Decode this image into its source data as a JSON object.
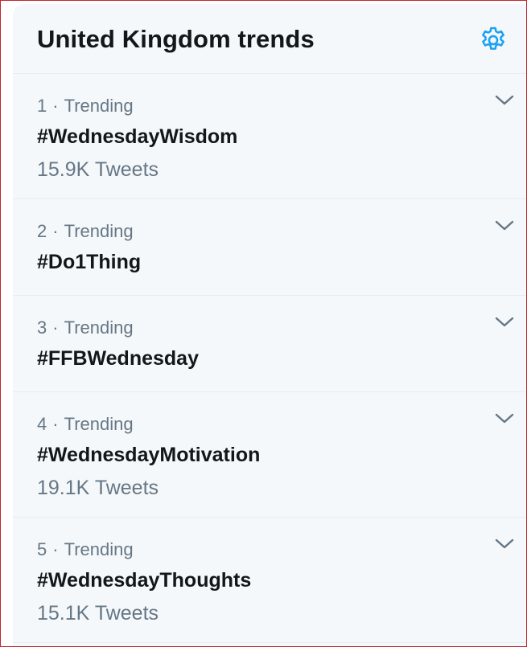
{
  "panel": {
    "title": "United Kingdom trends",
    "settings_icon": "gear-icon"
  },
  "trends": [
    {
      "rank": "1",
      "context": "Trending",
      "separator": "·",
      "name": "#WednesdayWisdom",
      "tweets": "15.9K Tweets"
    },
    {
      "rank": "2",
      "context": "Trending",
      "separator": "·",
      "name": "#Do1Thing",
      "tweets": ""
    },
    {
      "rank": "3",
      "context": "Trending",
      "separator": "·",
      "name": "#FFBWednesday",
      "tweets": ""
    },
    {
      "rank": "4",
      "context": "Trending",
      "separator": "·",
      "name": "#WednesdayMotivation",
      "tweets": "19.1K Tweets"
    },
    {
      "rank": "5",
      "context": "Trending",
      "separator": "·",
      "name": "#WednesdayThoughts",
      "tweets": "15.1K Tweets"
    }
  ],
  "colors": {
    "accent": "#1da1f2",
    "text_primary": "#14171a",
    "text_secondary": "#657786",
    "panel_bg": "#f5f8fa",
    "divider": "#e6ecf0",
    "frame_border": "#c0262d"
  }
}
